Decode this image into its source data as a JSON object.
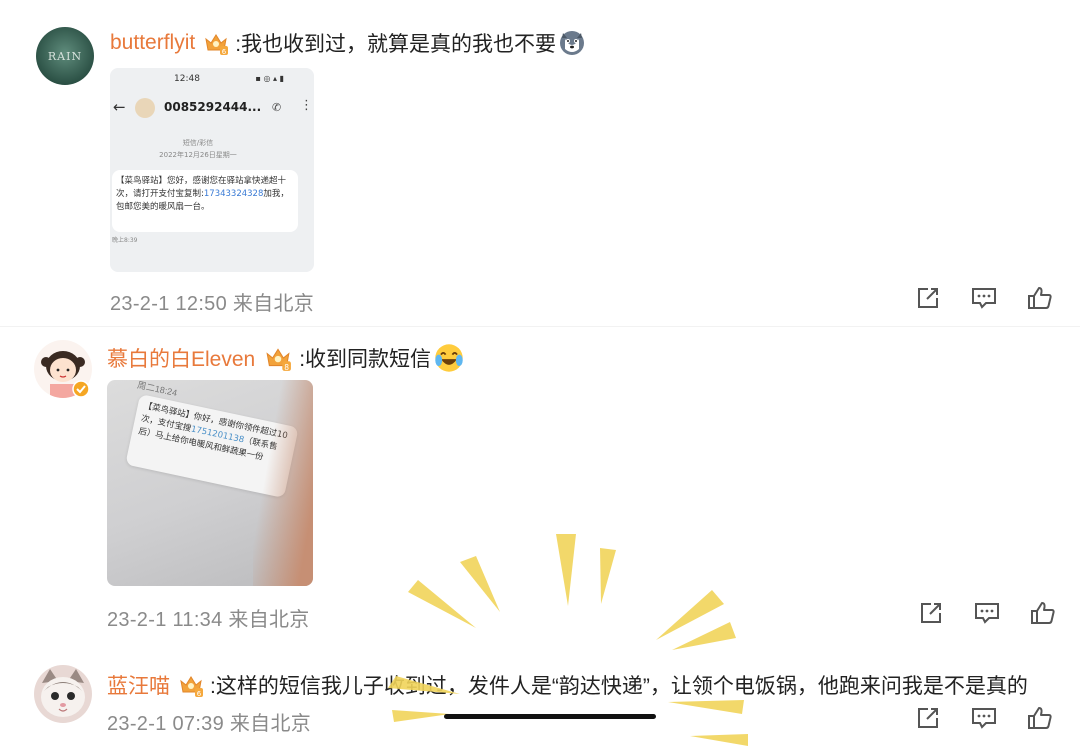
{
  "comments": [
    {
      "username": "butterflyit",
      "text": ":我也收到过，就算是真的我也不要",
      "emoji": "husky-dog-emoji",
      "timestamp": "23-2-1 12:50 来自北京",
      "image": {
        "time": "12:48",
        "status_icons": "▣ ◉ ᯤ 􀛨",
        "sender": "0085292444...",
        "type_label": "短信/彩信",
        "date": "2022年12月26日星期一",
        "message_before_link": "【菜鸟驿站】您好，感谢您在驿站拿快递超十次，请打开支付宝复制:",
        "link": "17343324328",
        "message_after_link": "加我，包邮您美的暖风扇一台。",
        "sent_time": "晚上8:39"
      }
    },
    {
      "username": "慕白的白Eleven",
      "text": ":收到同款短信",
      "emoji": "laughing-tears-emoji",
      "timestamp": "23-2-1 11:34 来自北京",
      "image": {
        "time": "周二18:24",
        "message_before_link": "【菜鸟驿站】你好，感谢你领件超过10次，支付宝搜",
        "link": "1751201138",
        "message_after_link": "（联系售后）马上给你电暖风和鲜蔬果一份"
      }
    },
    {
      "username": "蓝汪喵",
      "text": ":这样的短信我儿子收到过，发件人是“韵达快递”，让领个电饭锅，他跑来问我是不是真的",
      "timestamp": "23-2-1 07:39 来自北京"
    }
  ],
  "colors": {
    "username": "#e8793b",
    "meta": "#8a8a8a",
    "decoration": "#f1d45a"
  },
  "actions": [
    "share-icon",
    "comment-icon",
    "like-icon"
  ]
}
